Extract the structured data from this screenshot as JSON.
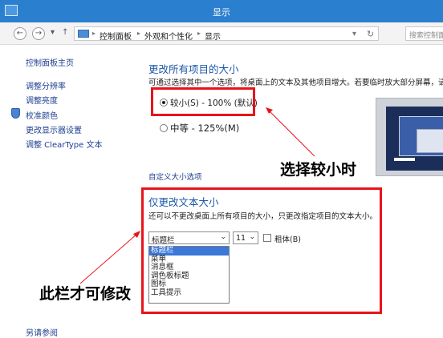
{
  "window": {
    "title": "显示"
  },
  "nav": {
    "back": "←",
    "forward": "→",
    "dropdown": "▾",
    "up": "↑",
    "refresh": "↻"
  },
  "breadcrumb": {
    "items": [
      "控制面板",
      "外观和个性化",
      "显示"
    ],
    "separator": "▸",
    "menu_caret": "▾"
  },
  "search": {
    "placeholder": "搜索控制面板"
  },
  "sidebar": {
    "items": [
      {
        "label": "控制面板主页"
      },
      {
        "label": "调整分辨率"
      },
      {
        "label": "调整亮度"
      },
      {
        "label": "校准颜色"
      },
      {
        "label": "更改显示器设置"
      },
      {
        "label": "调整 ClearType 文本"
      }
    ]
  },
  "size_section": {
    "heading": "更改所有项目的大小",
    "description": "可通过选择其中一个选项，将桌面上的文本及其他项目增大。若要临时放大部分屏幕，请",
    "options": [
      {
        "label": "较小(S) - 100% (默认)",
        "selected": true
      },
      {
        "label": "中等 - 125%(M)",
        "selected": false
      }
    ],
    "custom_link": "自定义大小选项"
  },
  "text_section": {
    "heading": "仅更改文本大小",
    "description": "还可以不更改桌面上所有项目的大小，只更改指定项目的文本大小。",
    "item_select": {
      "value": "标题栏",
      "options": [
        "标题栏",
        "菜单",
        "消息框",
        "调色板标题",
        "图标",
        "工具提示"
      ],
      "highlighted": "标题栏"
    },
    "size_select": {
      "value": "11"
    },
    "bold_checkbox": {
      "label": "粗体(B)",
      "checked": false
    }
  },
  "annotations": {
    "size_note": "选择较小时",
    "text_note": "此栏才可修改"
  },
  "footer": {
    "see_also": "另请参阅"
  },
  "colors": {
    "titlebar": "#2b7fcf",
    "link": "#1a56a6",
    "highlight_box": "#e8141c",
    "selection": "#3b78d8"
  }
}
